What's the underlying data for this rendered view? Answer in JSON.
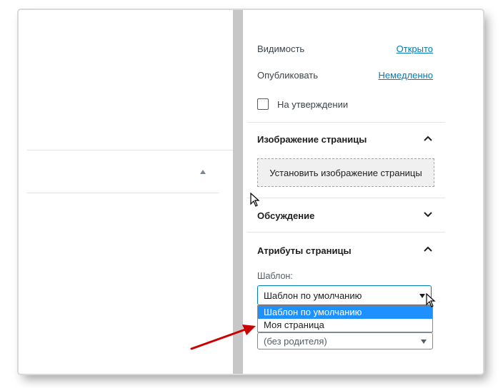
{
  "publish": {
    "visibility_label": "Видимость",
    "visibility_value": "Открыто",
    "publish_label": "Опубликовать",
    "publish_value": "Немедленно",
    "pending_label": "На утверждении"
  },
  "featured_image": {
    "title": "Изображение страницы",
    "set_button": "Установить изображение страницы"
  },
  "discussion": {
    "title": "Обсуждение"
  },
  "page_attributes": {
    "title": "Атрибуты страницы",
    "template_label": "Шаблон:",
    "template_value": "Шаблон по умолчанию",
    "template_options": [
      "Шаблон по умолчанию",
      "Моя страница"
    ],
    "parent_value": "(без родителя)"
  },
  "colors": {
    "accent": "#007cba",
    "highlight": "#1e90ff",
    "annotation": "#cc0000"
  }
}
